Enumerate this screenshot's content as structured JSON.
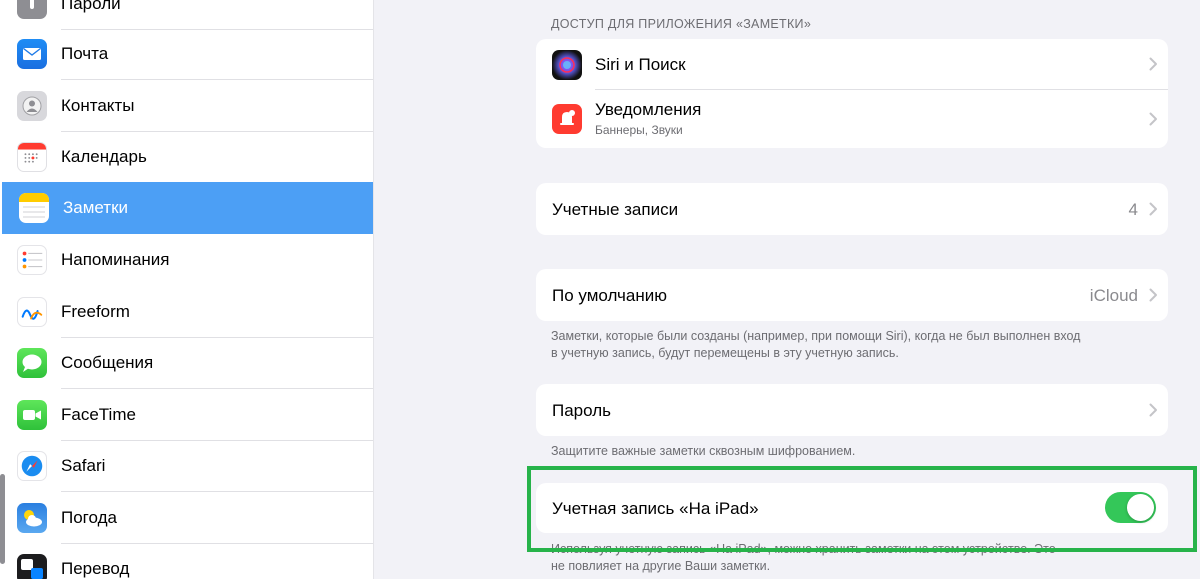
{
  "sidebar": {
    "items": [
      {
        "label": "Пароли",
        "icon": "key-icon"
      },
      {
        "label": "Почта",
        "icon": "mail-icon"
      },
      {
        "label": "Контакты",
        "icon": "contacts-icon"
      },
      {
        "label": "Календарь",
        "icon": "calendar-icon"
      },
      {
        "label": "Заметки",
        "icon": "notes-icon",
        "selected": true
      },
      {
        "label": "Напоминания",
        "icon": "reminders-icon"
      },
      {
        "label": "Freeform",
        "icon": "freeform-icon"
      },
      {
        "label": "Сообщения",
        "icon": "messages-icon"
      },
      {
        "label": "FaceTime",
        "icon": "facetime-icon"
      },
      {
        "label": "Safari",
        "icon": "safari-icon"
      },
      {
        "label": "Погода",
        "icon": "weather-icon"
      },
      {
        "label": "Перевод",
        "icon": "translate-icon"
      }
    ]
  },
  "main": {
    "access_header": "ДОСТУП ДЛЯ ПРИЛОЖЕНИЯ «ЗАМЕТКИ»",
    "siri": {
      "title": "Siri и Поиск",
      "icon": "siri-icon"
    },
    "notifications": {
      "title": "Уведомления",
      "subtitle": "Баннеры, Звуки",
      "icon": "notifications-icon"
    },
    "accounts": {
      "title": "Учетные записи",
      "value": "4"
    },
    "default": {
      "title": "По умолчанию",
      "value": "iCloud",
      "footer_line1": "Заметки, которые были созданы (например, при помощи Siri), когда не был выполнен вход",
      "footer_line2": "в учетную запись, будут перемещены в эту учетную запись."
    },
    "password": {
      "title": "Пароль",
      "footer": "Защитите важные заметки сквозным шифрованием."
    },
    "on_ipad": {
      "title": "Учетная запись «На iPad»",
      "enabled": true,
      "footer_line1": "Используя учетную запись «На iPad», можно хранить заметки на этом устройстве. Это",
      "footer_line2": "не повлияет на другие Ваши заметки."
    }
  },
  "colors": {
    "accent": "#4c9ff5",
    "toggle_on": "#34c759",
    "highlight": "#27b34a",
    "background": "#f2f2f7"
  }
}
